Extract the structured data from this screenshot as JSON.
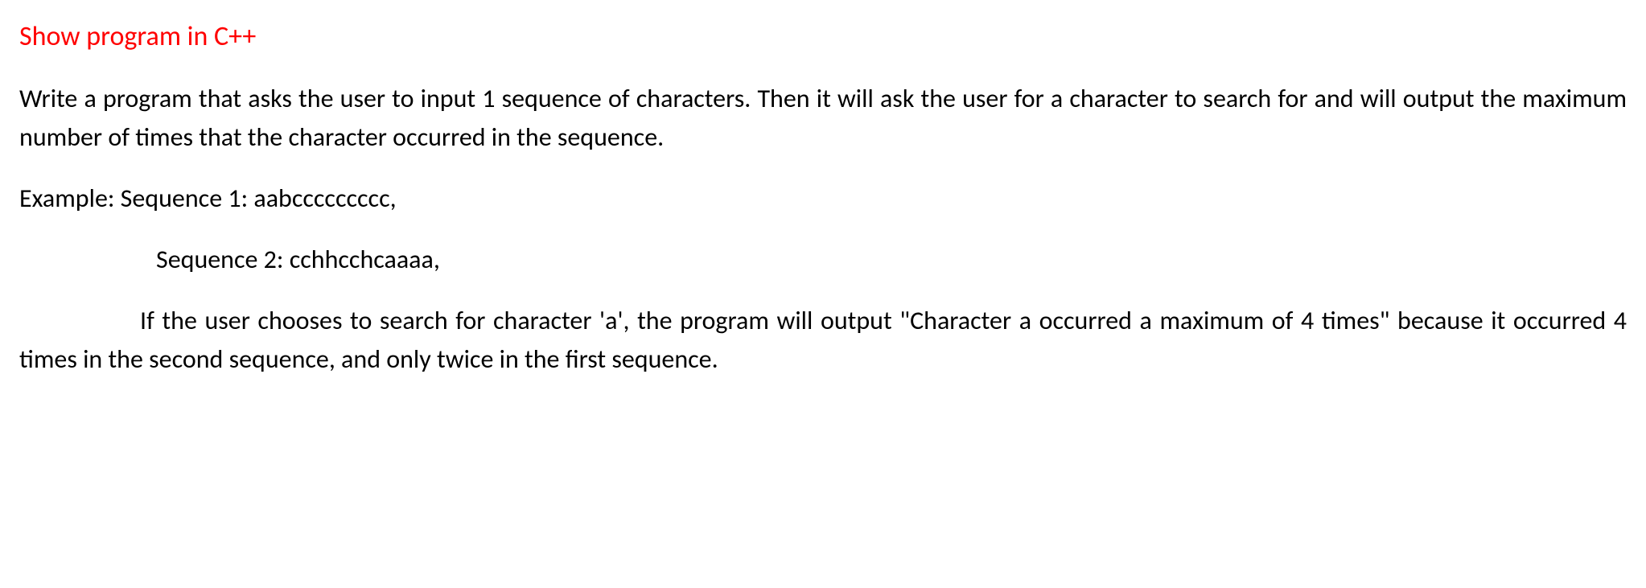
{
  "title": "Show program in C++",
  "paragraph1": "Write a program that asks the user to input 1 sequence of characters. Then it will ask the user for a character to search for and will output the maximum number of times that the character occurred in the sequence.",
  "example_label": "Example: Sequence 1: aabccccccccc,",
  "sequence2": "Sequence 2: cchhcchcaaaa,",
  "paragraph2_start": "If the user chooses to search for character 'a', the program will output \"Character a occurred a",
  "paragraph2_rest": "maximum of 4 times\" because it occurred 4 times in the second sequence, and only twice in the first sequence."
}
